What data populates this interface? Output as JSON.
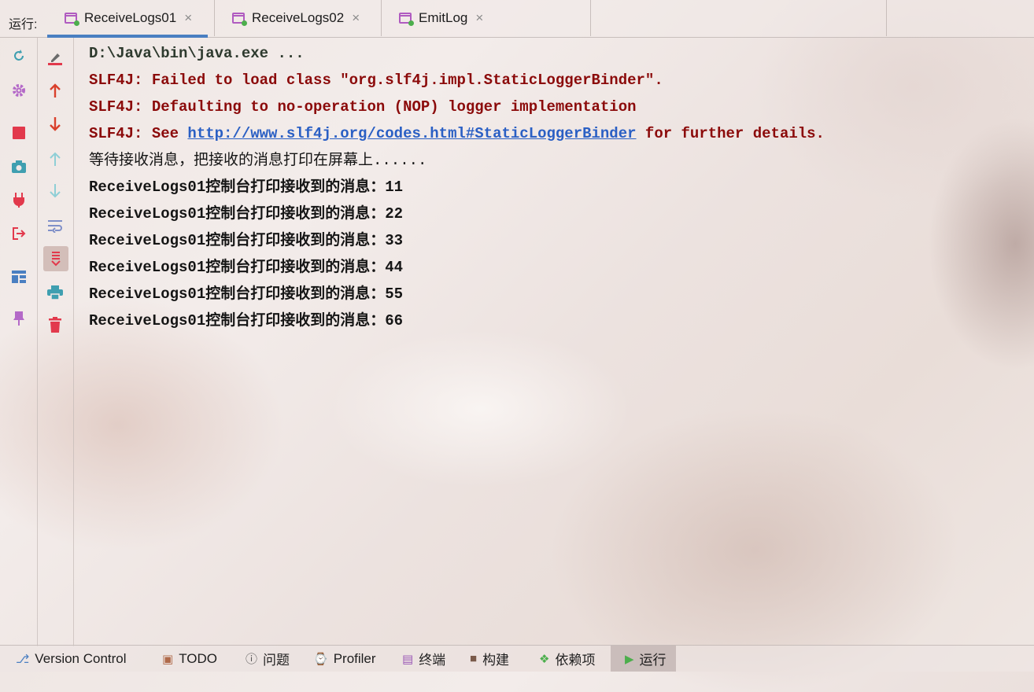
{
  "run_panel": {
    "label": "运行:",
    "tabs": [
      {
        "label": "ReceiveLogs01",
        "close": "×",
        "active": true
      },
      {
        "label": "ReceiveLogs02",
        "close": "×",
        "active": false
      },
      {
        "label": "EmitLog",
        "close": "×",
        "active": false
      }
    ]
  },
  "console": {
    "command": "D:\\Java\\bin\\java.exe ...",
    "slf4j_1": "SLF4J: Failed to load class \"org.slf4j.impl.StaticLoggerBinder\".",
    "slf4j_2": "SLF4J: Defaulting to no-operation (NOP) logger implementation",
    "slf4j_3_prefix": "SLF4J: See ",
    "slf4j_3_link": "http://www.slf4j.org/codes.html#StaticLoggerBinder",
    "slf4j_3_suffix": " for further details.",
    "waiting": "等待接收消息，把接收的消息打印在屏幕上......",
    "messages": [
      "ReceiveLogs01控制台打印接收到的消息：11",
      "ReceiveLogs01控制台打印接收到的消息：22",
      "ReceiveLogs01控制台打印接收到的消息：33",
      "ReceiveLogs01控制台打印接收到的消息：44",
      "ReceiveLogs01控制台打印接收到的消息：55",
      "ReceiveLogs01控制台打印接收到的消息：66"
    ]
  },
  "bottom_bar": {
    "version_control": "Version Control",
    "todo": "TODO",
    "problems": "问题",
    "profiler": "Profiler",
    "terminal": "终端",
    "build": "构建",
    "dependencies": "依赖项",
    "run": "运行"
  },
  "colors": {
    "accent": "#4a7fc1",
    "error_text": "#8b0a0a",
    "link": "#2a5fc4",
    "tab_icon": "#b05bc0",
    "run_dot": "#4cae4c"
  }
}
